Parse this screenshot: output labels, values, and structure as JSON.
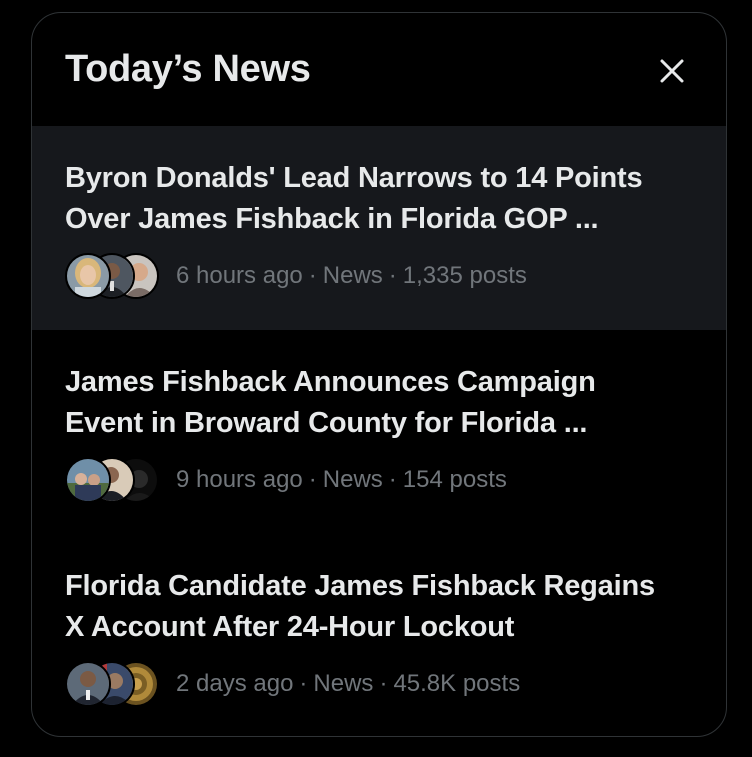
{
  "panel": {
    "title": "Today’s News",
    "close_label": "Close"
  },
  "news": [
    {
      "headline_line1": "Byron Donalds' Lead Narrows to 14 Points",
      "headline_line2": "Over James Fishback in Florida GOP ...",
      "time": "6 hours ago",
      "category": "News",
      "posts": "1,335 posts",
      "avatars": [
        "avatar-woman-blonde",
        "avatar-man-suit",
        "avatar-man-portrait"
      ]
    },
    {
      "headline_line1": "James Fishback Announces Campaign",
      "headline_line2": "Event in Broward County for Florida ...",
      "time": "9 hours ago",
      "category": "News",
      "posts": "154 posts",
      "avatars": [
        "avatar-group-outdoor",
        "avatar-man-suit",
        "avatar-dark-portrait"
      ]
    },
    {
      "headline_line1": "Florida Candidate James Fishback Regains",
      "headline_line2": "X Account After 24-Hour Lockout",
      "time": "2 days ago",
      "category": "News",
      "posts": "45.8K posts",
      "avatars": [
        "avatar-man-suit",
        "avatar-man-flag",
        "avatar-seal"
      ]
    }
  ],
  "colors": {
    "background": "#000000",
    "hover_row": "#16181c",
    "text_primary": "#e7e9ea",
    "text_secondary": "#71767b",
    "border": "#2f3336"
  }
}
